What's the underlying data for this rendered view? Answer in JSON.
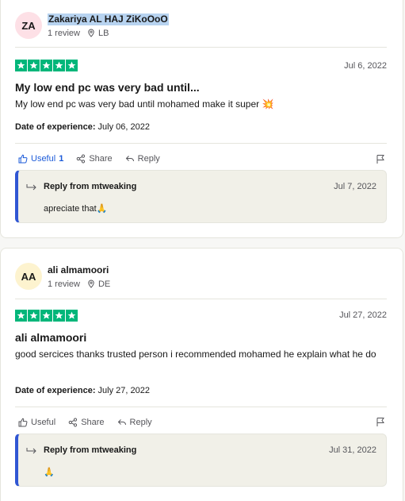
{
  "reviews": [
    {
      "avatar_initials": "ZA",
      "avatar_color": "#fde0e6",
      "name": "Zakariya AL HAJ ZiKoOoO",
      "review_count": "1 review",
      "country": "LB",
      "rating": 5,
      "date": "Jul 6, 2022",
      "title": "My low end pc was very bad until...",
      "body": "My low end pc was very bad until mohamed make it super 💥",
      "experience_label": "Date of experience:",
      "experience_date": "July 06, 2022",
      "useful_label": "Useful",
      "useful_count": "1",
      "share_label": "Share",
      "reply_label": "Reply",
      "reply": {
        "from": "Reply from mtweaking",
        "date": "Jul 7, 2022",
        "text": "apreciate that🙏"
      }
    },
    {
      "avatar_initials": "AA",
      "avatar_color": "#fdf3cf",
      "name": "ali almamoori",
      "review_count": "1 review",
      "country": "DE",
      "rating": 5,
      "date": "Jul 27, 2022",
      "title": "ali almamoori",
      "body": "good sercices thanks trusted person i recommended mohamed he explain what he do",
      "experience_label": "Date of experience:",
      "experience_date": "July 27, 2022",
      "useful_label": "Useful",
      "useful_count": "",
      "share_label": "Share",
      "reply_label": "Reply",
      "reply": {
        "from": "Reply from mtweaking",
        "date": "Jul 31, 2022",
        "text": "🙏"
      }
    }
  ],
  "colors": {
    "star": "#00b67a",
    "accent": "#1c5bd9",
    "reply_border": "#3056d3"
  },
  "icons": [
    "location-pin-icon",
    "thumbs-up-icon",
    "share-icon",
    "reply-arrow-icon",
    "flag-icon",
    "star-icon"
  ]
}
